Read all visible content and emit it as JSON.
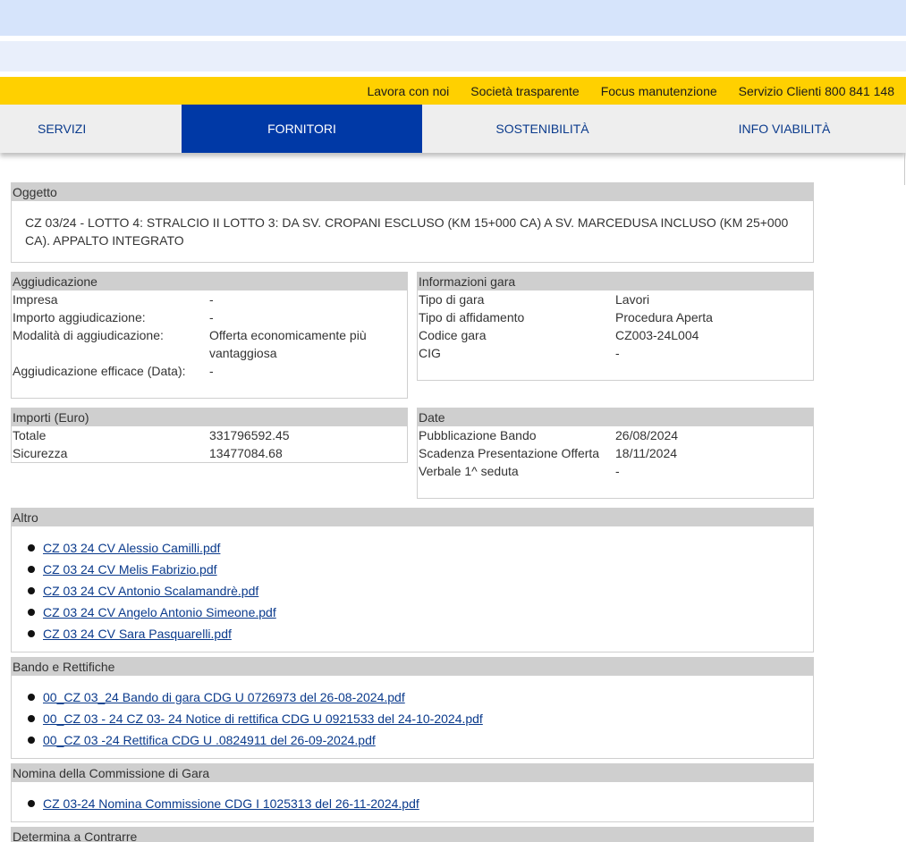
{
  "topbar": {
    "links": [
      "Lavora con noi",
      "Società trasparente",
      "Focus manutenzione",
      "Servizio Clienti 800 841 148"
    ]
  },
  "nav": {
    "tabs": [
      "SERVIZI",
      "FORNITORI",
      "SOSTENIBILITÀ",
      "INFO VIABILITÀ"
    ],
    "active": "FORNITORI"
  },
  "oggetto": {
    "title": "Oggetto",
    "text": "CZ 03/24 - LOTTO 4: STRALCIO II LOTTO 3: DA SV. CROPANI ESCLUSO (KM 15+000 CA) A SV. MARCEDUSA INCLUSO (KM 25+000 CA). APPALTO INTEGRATO"
  },
  "aggiudicazione": {
    "title": "Aggiudicazione",
    "rows": [
      {
        "k": "Impresa",
        "v": "-"
      },
      {
        "k": "Importo aggiudicazione:",
        "v": "-"
      },
      {
        "k": "Modalità di aggiudicazione:",
        "v": "Offerta economicamente più vantaggiosa"
      },
      {
        "k": "Aggiudicazione efficace (Data):",
        "v": "-"
      }
    ]
  },
  "informazioni": {
    "title": "Informazioni gara",
    "rows": [
      {
        "k": "Tipo di gara",
        "v": "Lavori"
      },
      {
        "k": "Tipo di affidamento",
        "v": "Procedura Aperta"
      },
      {
        "k": "Codice gara",
        "v": "CZ003-24L004"
      },
      {
        "k": "CIG",
        "v": "-"
      }
    ]
  },
  "importi": {
    "title": "Importi (Euro)",
    "rows": [
      {
        "k": "Totale",
        "v": "331796592.45"
      },
      {
        "k": "Sicurezza",
        "v": "13477084.68"
      }
    ]
  },
  "date": {
    "title": "Date",
    "rows": [
      {
        "k": "Pubblicazione Bando",
        "v": "26/08/2024"
      },
      {
        "k": "Scadenza Presentazione Offerta",
        "v": "18/11/2024"
      },
      {
        "k": "Verbale 1^ seduta",
        "v": "-"
      }
    ]
  },
  "altro": {
    "title": "Altro",
    "files": [
      "CZ 03 24 CV Alessio Camilli.pdf",
      "CZ 03 24 CV Melis Fabrizio.pdf",
      "CZ 03 24 CV Antonio Scalamandrè.pdf",
      "CZ 03 24 CV Angelo Antonio Simeone.pdf",
      "CZ 03 24 CV Sara Pasquarelli.pdf"
    ]
  },
  "bando": {
    "title": "Bando e Rettifiche",
    "files": [
      "00_CZ 03_24 Bando di gara CDG U 0726973 del 26-08-2024.pdf",
      "00_CZ 03 - 24 CZ 03- 24 Notice di rettifica CDG U 0921533 del 24-10-2024.pdf",
      "00_CZ 03 -24 Rettifica CDG U .0824911 del 26-09-2024.pdf"
    ]
  },
  "nomina": {
    "title": "Nomina della Commissione di Gara",
    "files": [
      "CZ 03-24 Nomina Commissione CDG I 1025313 del 26-11-2024.pdf"
    ]
  },
  "determina": {
    "title": "Determina a Contrarre"
  }
}
